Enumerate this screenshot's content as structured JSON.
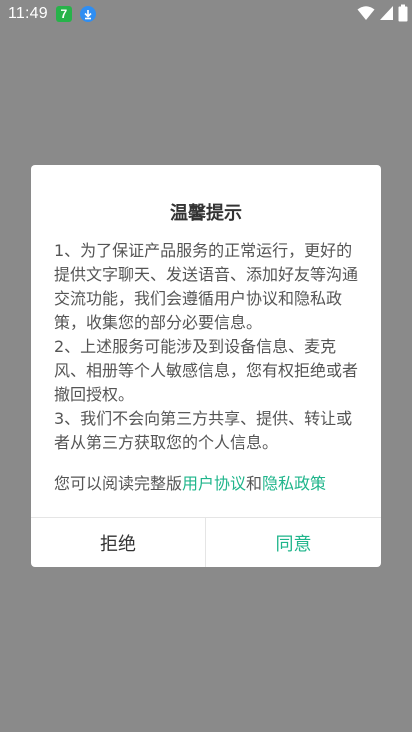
{
  "status_bar": {
    "time": "11:49",
    "app_notification_badge": "7",
    "icons": [
      "app-notification-icon",
      "download-icon",
      "wifi-icon",
      "signal-icon",
      "battery-icon"
    ]
  },
  "dialog": {
    "title": "温馨提示",
    "paragraphs": [
      "1、为了保证产品服务的正常运行，更好的提供文字聊天、发送语音、添加好友等沟通交流功能，我们会遵循用户协议和隐私政策，收集您的部分必要信息。",
      "2、上述服务可能涉及到设备信息、麦克风、相册等个人敏感信息，您有权拒绝或者撤回授权。",
      "3、我们不会向第三方共享、提供、转让或者从第三方获取您的个人信息。"
    ],
    "read_prefix": "您可以阅读完整版",
    "user_agreement_link": "用户协议",
    "and_text": "和",
    "privacy_policy_link": "隐私政策",
    "reject_label": "拒绝",
    "agree_label": "同意"
  },
  "colors": {
    "accent": "#1fb58b",
    "overlay": "#8a8a8a",
    "text": "#555555"
  }
}
